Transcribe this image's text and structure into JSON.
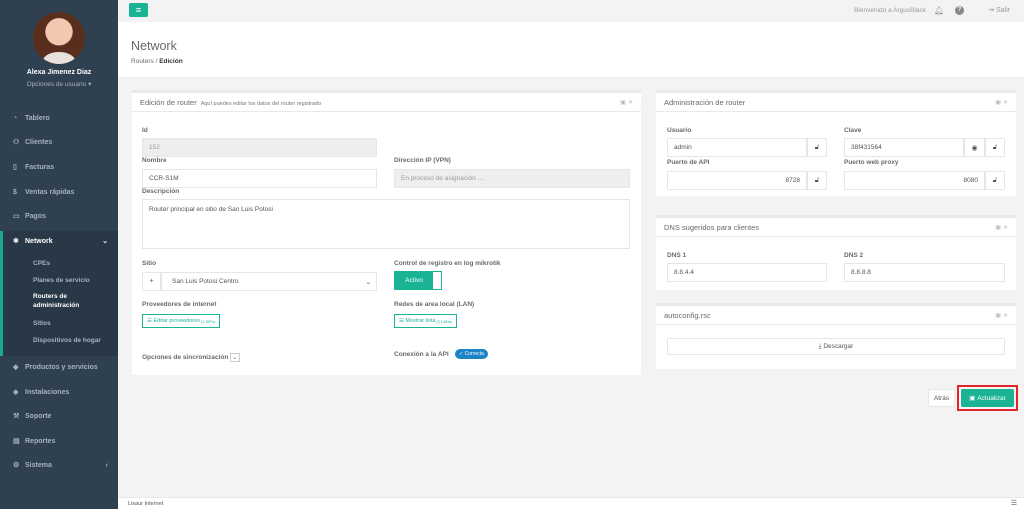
{
  "user": {
    "name": "Alexa Jimenez Diaz",
    "options": "Opciones de usuario"
  },
  "nav": {
    "tablero": "Tablero",
    "clientes": "Clientes",
    "facturas": "Facturas",
    "ventas": "Ventas rápidas",
    "pagos": "Pagos",
    "network": "Network",
    "sub": {
      "cpes": "CPEs",
      "planes": "Planes de servicio",
      "routers": "Routers de administración",
      "sitios": "Sitios",
      "dispositivos": "Dispositivos de hogar"
    },
    "productos": "Productos y servicios",
    "instalaciones": "Instalaciones",
    "soporte": "Soporte",
    "reportes": "Reportes",
    "sistema": "Sistema"
  },
  "topbar": {
    "welcome": "Bienvenido a ArgusBlack",
    "logout": "Salir"
  },
  "page": {
    "title": "Network",
    "breadcrumb_parent": "Routers",
    "breadcrumb_current": "Edición"
  },
  "edit": {
    "title": "Edición de router",
    "subtitle": "Aquí puedes editar los datos del router registrado",
    "id_label": "Id",
    "id_value": "152",
    "nombre_label": "Nombre",
    "nombre_value": "CCR-S1M",
    "dir_label": "Dirección IP (VPN)",
    "dir_value": "En proceso de asignación ...",
    "desc_label": "Descripción",
    "desc_value": "Router principal en sitio de San Luis Potosi",
    "sitio_label": "Sitio",
    "sitio_value": "San Luis Potosi Centro",
    "control_label": "Control de registro en log mikrotik",
    "control_value": "Activo",
    "prov_label": "Proveedores de internet",
    "prov_btn": "Editar proveedores",
    "prov_sup": "(1 ISPs)",
    "lan_label": "Redes de area local (LAN)",
    "lan_btn": "Mostrar lista",
    "lan_sup": "(3 LANs)",
    "sync_label": "Opciones de sincronización",
    "conn_label": "Conexión a la API",
    "conn_badge": "Correcta"
  },
  "admin": {
    "title": "Administración de router",
    "usuario_label": "Usuario",
    "usuario_value": "admin",
    "clave_label": "Clave",
    "clave_value": "38f431564",
    "api_label": "Puerto de API",
    "api_value": "8728",
    "proxy_label": "Puerto web proxy",
    "proxy_value": "8080"
  },
  "dns": {
    "title": "DNS sugeridos para clientes",
    "dns1_label": "DNS 1",
    "dns1_value": "8.8.4.4",
    "dns2_label": "DNS 2",
    "dns2_value": "8.8.8.8"
  },
  "autoconfig": {
    "title": "autoconfig.rsc",
    "download": "Descargar"
  },
  "actions": {
    "back": "Atrás",
    "update": "Actualizar"
  },
  "footer": {
    "text": "Lixaur Internet"
  },
  "colors": {
    "accent": "#1ab394",
    "sidebar": "#2f4050",
    "highlight": "#e3242b",
    "badge": "#1c84c6"
  }
}
